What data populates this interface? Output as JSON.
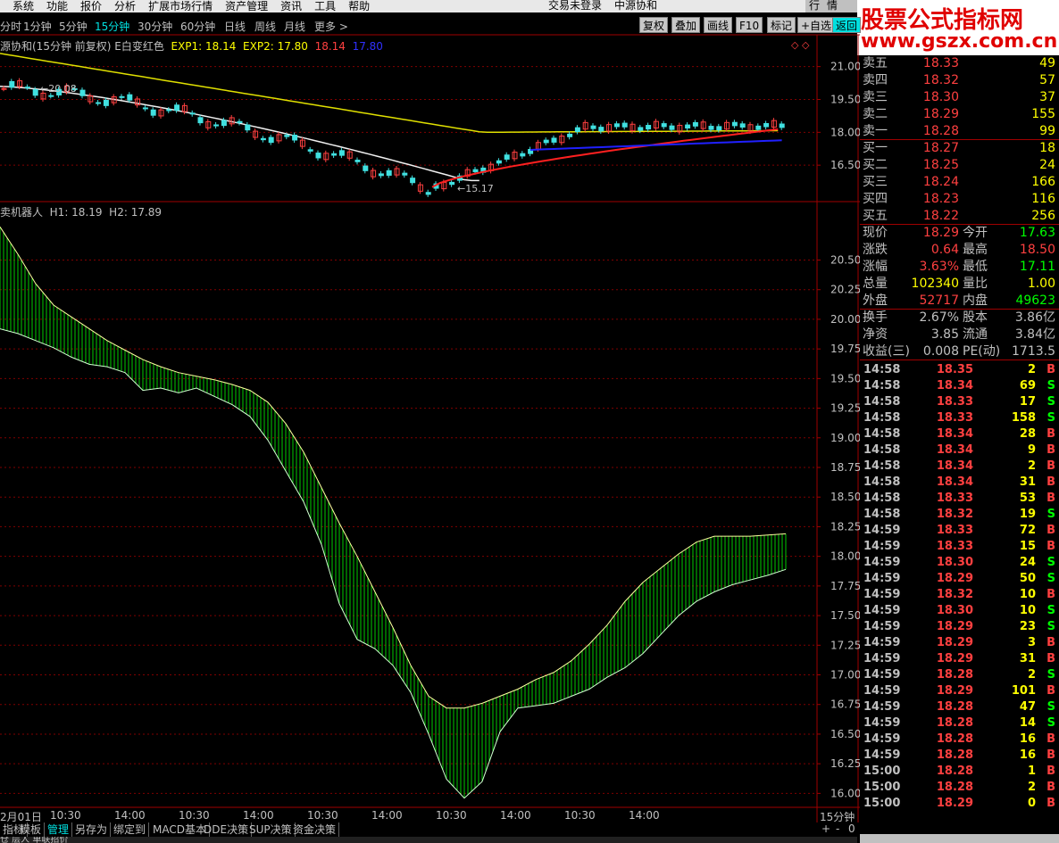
{
  "menu": [
    "系统",
    "功能",
    "报价",
    "分析",
    "扩展市场行情",
    "资产管理",
    "资讯",
    "工具",
    "帮助"
  ],
  "login_status": "交易未登录",
  "stock_name": "中源协和",
  "hangqing": [
    "行",
    "情"
  ],
  "watermark": {
    "title": "股票公式指标网",
    "url": "www.gszx.com.cn"
  },
  "periods": [
    "分时",
    "1分钟",
    "5分钟",
    "15分钟",
    "30分钟",
    "60分钟",
    "日线",
    "周线",
    "月线",
    "更多 >"
  ],
  "active_period": "15分钟",
  "toolbar": {
    "fuquan": "复权",
    "diejia": "叠加",
    "huaxian": "画线",
    "f10": "F10",
    "biaoji": "标记",
    "zixuan": "+自选",
    "fanhui": "返回"
  },
  "main_header": {
    "title": "源协和(15分钟 前复权) E白变红色",
    "exp1_label": "EXP1: 18.14",
    "exp2_label": "EXP2: 17.80",
    "v1": "18.14",
    "v2": "17.80"
  },
  "main_markers": {
    "high": "20.08",
    "low": "15.17",
    "diamonds": "◇ ◇"
  },
  "sub_header": {
    "title": "卖机器人",
    "h1": "H1: 18.19",
    "h2": "H2: 17.89"
  },
  "chart_data": [
    {
      "type": "candlestick",
      "title": "源协和(15分钟 前复权)",
      "yticks": [
        21.0,
        19.5,
        18.0,
        16.5
      ],
      "ylim": [
        15.0,
        21.8
      ],
      "series": [
        {
          "name": "EXP1",
          "color": "#ff2020",
          "last": 18.14
        },
        {
          "name": "EXP2",
          "color": "#2020ff",
          "last": 17.8
        }
      ],
      "annotations": [
        {
          "text": "20.08",
          "type": "high"
        },
        {
          "text": "15.17",
          "type": "low"
        }
      ]
    },
    {
      "type": "area",
      "title": "卖机器人",
      "yticks": [
        20.5,
        20.25,
        20.0,
        19.75,
        19.5,
        19.25,
        19.0,
        18.75,
        18.5,
        18.25,
        18.0,
        17.75,
        17.5,
        17.25,
        17.0,
        16.75,
        16.5,
        16.25,
        16.0
      ],
      "ylim": [
        15.92,
        20.85
      ],
      "series": [
        {
          "name": "H1",
          "last": 18.19
        },
        {
          "name": "H2",
          "last": 17.89
        }
      ],
      "h1": [
        20.78,
        20.55,
        20.3,
        20.12,
        20.02,
        19.92,
        19.82,
        19.74,
        19.66,
        19.6,
        19.55,
        19.52,
        19.49,
        19.45,
        19.4,
        19.3,
        19.12,
        18.88,
        18.58,
        18.28,
        18.0,
        17.7,
        17.4,
        17.08,
        16.82,
        16.72,
        16.72,
        16.76,
        16.82,
        16.88,
        16.96,
        17.02,
        17.12,
        17.26,
        17.42,
        17.62,
        17.78,
        17.9,
        18.02,
        18.12,
        18.17,
        18.17,
        18.17,
        18.18,
        18.19
      ],
      "h2": [
        19.92,
        19.88,
        19.82,
        19.76,
        19.68,
        19.62,
        19.6,
        19.55,
        19.4,
        19.42,
        19.38,
        19.42,
        19.35,
        19.28,
        19.18,
        18.98,
        18.72,
        18.46,
        18.1,
        17.6,
        17.3,
        17.22,
        17.08,
        16.85,
        16.5,
        16.12,
        15.96,
        16.1,
        16.52,
        16.72,
        16.74,
        16.76,
        16.82,
        16.88,
        16.98,
        17.06,
        17.18,
        17.34,
        17.5,
        17.62,
        17.7,
        17.76,
        17.8,
        17.84,
        17.89
      ]
    }
  ],
  "time_axis": [
    "2月01日",
    "10:30",
    "14:00",
    "10:30",
    "14:00",
    "10:30",
    "14:00",
    "10:30",
    "14:00",
    "10:30",
    "14:00"
  ],
  "period_label": "15分钟",
  "bottom_tabs": [
    "指标",
    "模板",
    "管理",
    "另存为",
    "绑定到",
    "MACD基本",
    "DDE决策",
    "SUP决策",
    "资金决策"
  ],
  "active_tab": "管理",
  "bottom_status": "仓 层人 单联招价",
  "nav": {
    "plus": "+",
    "minus": "-",
    "zero": "0"
  },
  "orderbook": {
    "sell": [
      {
        "label": "卖五",
        "price": "18.33",
        "vol": "49"
      },
      {
        "label": "卖四",
        "price": "18.32",
        "vol": "57"
      },
      {
        "label": "卖三",
        "price": "18.30",
        "vol": "37"
      },
      {
        "label": "卖二",
        "price": "18.29",
        "vol": "155"
      },
      {
        "label": "卖一",
        "price": "18.28",
        "vol": "99"
      }
    ],
    "buy": [
      {
        "label": "买一",
        "price": "18.27",
        "vol": "18"
      },
      {
        "label": "买二",
        "price": "18.25",
        "vol": "24"
      },
      {
        "label": "买三",
        "price": "18.24",
        "vol": "166"
      },
      {
        "label": "买四",
        "price": "18.23",
        "vol": "116"
      },
      {
        "label": "买五",
        "price": "18.22",
        "vol": "256"
      }
    ]
  },
  "quote": [
    {
      "l1": "现价",
      "v1": "18.29",
      "c1": "#ff4040",
      "l2": "今开",
      "v2": "17.63",
      "c2": "#00ff00"
    },
    {
      "l1": "涨跌",
      "v1": "0.64",
      "c1": "#ff4040",
      "l2": "最高",
      "v2": "18.50",
      "c2": "#ff4040"
    },
    {
      "l1": "涨幅",
      "v1": "3.63%",
      "c1": "#ff4040",
      "l2": "最低",
      "v2": "17.11",
      "c2": "#00ff00"
    },
    {
      "l1": "总量",
      "v1": "102340",
      "c1": "#ffff00",
      "l2": "量比",
      "v2": "1.00",
      "c2": "#ffff00"
    },
    {
      "l1": "外盘",
      "v1": "52717",
      "c1": "#ff4040",
      "l2": "内盘",
      "v2": "49623",
      "c2": "#00ff00"
    },
    {
      "l1": "换手",
      "v1": "2.67%",
      "c1": "#c0c0c0",
      "l2": "股本",
      "v2": "3.86亿",
      "c2": "#c0c0c0"
    },
    {
      "l1": "净资",
      "v1": "3.85",
      "c1": "#c0c0c0",
      "l2": "流通",
      "v2": "3.84亿",
      "c2": "#c0c0c0"
    },
    {
      "l1": "收益(三)",
      "v1": "0.008",
      "c1": "#c0c0c0",
      "l2": "PE(动)",
      "v2": "1713.5",
      "c2": "#c0c0c0"
    }
  ],
  "ticks": [
    {
      "t": "14:58",
      "p": "18.35",
      "v": "2",
      "bs": "B"
    },
    {
      "t": "14:58",
      "p": "18.34",
      "v": "69",
      "bs": "S"
    },
    {
      "t": "14:58",
      "p": "18.33",
      "v": "17",
      "bs": "S"
    },
    {
      "t": "14:58",
      "p": "18.33",
      "v": "158",
      "bs": "S"
    },
    {
      "t": "14:58",
      "p": "18.34",
      "v": "28",
      "bs": "B"
    },
    {
      "t": "14:58",
      "p": "18.34",
      "v": "9",
      "bs": "B"
    },
    {
      "t": "14:58",
      "p": "18.34",
      "v": "2",
      "bs": "B"
    },
    {
      "t": "14:58",
      "p": "18.34",
      "v": "31",
      "bs": "B"
    },
    {
      "t": "14:58",
      "p": "18.33",
      "v": "53",
      "bs": "B"
    },
    {
      "t": "14:58",
      "p": "18.32",
      "v": "19",
      "bs": "S"
    },
    {
      "t": "14:59",
      "p": "18.33",
      "v": "72",
      "bs": "B"
    },
    {
      "t": "14:59",
      "p": "18.33",
      "v": "15",
      "bs": "B"
    },
    {
      "t": "14:59",
      "p": "18.30",
      "v": "24",
      "bs": "S"
    },
    {
      "t": "14:59",
      "p": "18.29",
      "v": "50",
      "bs": "S"
    },
    {
      "t": "14:59",
      "p": "18.32",
      "v": "10",
      "bs": "B"
    },
    {
      "t": "14:59",
      "p": "18.30",
      "v": "10",
      "bs": "S"
    },
    {
      "t": "14:59",
      "p": "18.29",
      "v": "23",
      "bs": "S"
    },
    {
      "t": "14:59",
      "p": "18.29",
      "v": "3",
      "bs": "B"
    },
    {
      "t": "14:59",
      "p": "18.29",
      "v": "31",
      "bs": "B"
    },
    {
      "t": "14:59",
      "p": "18.28",
      "v": "2",
      "bs": "S"
    },
    {
      "t": "14:59",
      "p": "18.29",
      "v": "101",
      "bs": "B"
    },
    {
      "t": "14:59",
      "p": "18.28",
      "v": "47",
      "bs": "S"
    },
    {
      "t": "14:59",
      "p": "18.28",
      "v": "14",
      "bs": "S"
    },
    {
      "t": "14:59",
      "p": "18.28",
      "v": "16",
      "bs": "B"
    },
    {
      "t": "14:59",
      "p": "18.28",
      "v": "16",
      "bs": "B"
    },
    {
      "t": "15:00",
      "p": "18.28",
      "v": "1",
      "bs": "B"
    },
    {
      "t": "15:00",
      "p": "18.28",
      "v": "2",
      "bs": "B"
    },
    {
      "t": "15:00",
      "p": "18.29",
      "v": "0",
      "bs": "B"
    }
  ]
}
